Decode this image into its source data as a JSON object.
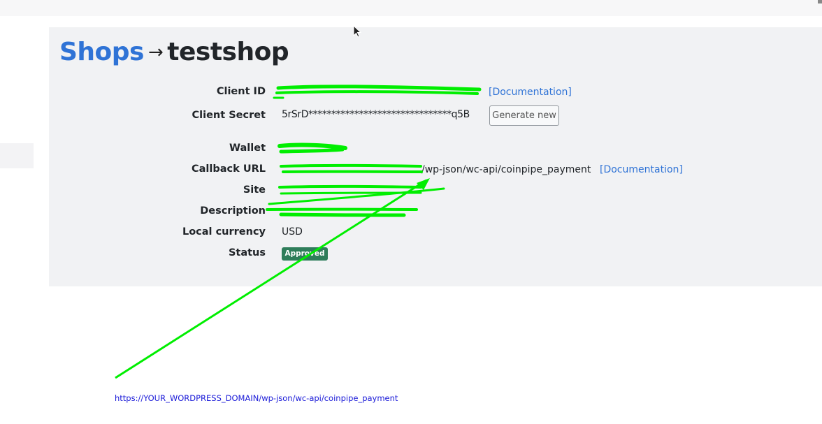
{
  "header": {
    "shops_link": "Shops",
    "arrow": "→",
    "shop_name": "testshop"
  },
  "fields": {
    "client_id": {
      "label": "Client ID",
      "value": "",
      "doc_link": "[Documentation]"
    },
    "client_secret": {
      "label": "Client Secret",
      "value": "5rSrD*******************************q5B",
      "button": "Generate new"
    },
    "wallet": {
      "label": "Wallet",
      "value": ""
    },
    "callback_url": {
      "label": "Callback URL",
      "value": "/wp-json/wc-api/coinpipe_payment",
      "doc_link": "[Documentation]"
    },
    "site": {
      "label": "Site",
      "value": ""
    },
    "description": {
      "label": "Description",
      "value": ""
    },
    "local_currency": {
      "label": "Local currency",
      "value": "USD"
    },
    "status": {
      "label": "Status",
      "value": "Approved"
    }
  },
  "annotation": {
    "url": "https://YOUR_WORDPRESS_DOMAIN/wp-json/wc-api/coinpipe_payment",
    "color": "#00ee00"
  },
  "colors": {
    "link": "#2f73d6",
    "badge": "#2e7d5a",
    "scribble": "#00ee00"
  }
}
